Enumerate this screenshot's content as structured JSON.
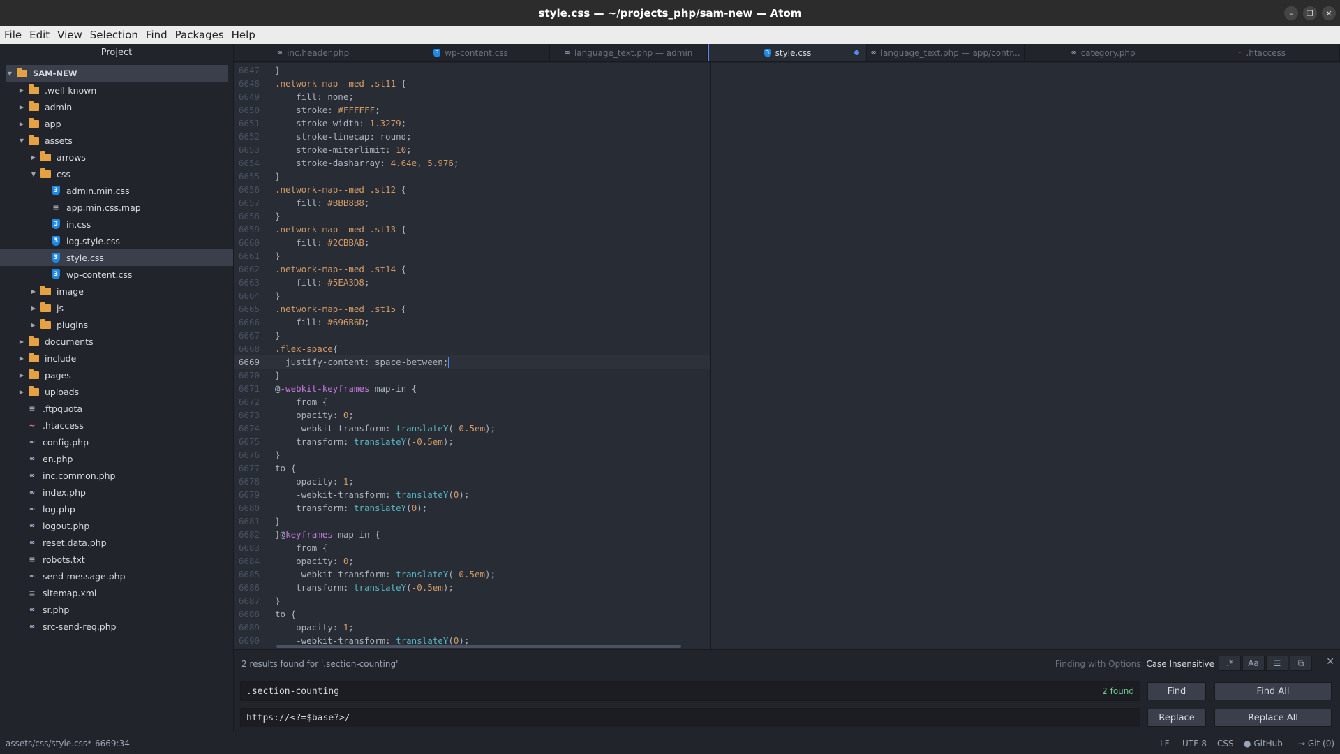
{
  "window": {
    "title": "style.css — ~/projects_php/sam-new — Atom",
    "minimize_glyph": "–",
    "restore_glyph": "❐",
    "close_glyph": "✕"
  },
  "menu": [
    "File",
    "Edit",
    "View",
    "Selection",
    "Find",
    "Packages",
    "Help"
  ],
  "tree": {
    "header": "Project",
    "root": "SAM-NEW",
    "items": [
      {
        "label": ".well-known",
        "type": "folder",
        "depth": 1,
        "expanded": false
      },
      {
        "label": "admin",
        "type": "folder",
        "depth": 1,
        "expanded": false
      },
      {
        "label": "app",
        "type": "folder",
        "depth": 1,
        "expanded": false
      },
      {
        "label": "assets",
        "type": "folder",
        "depth": 1,
        "expanded": true
      },
      {
        "label": "arrows",
        "type": "folder",
        "depth": 2,
        "expanded": false
      },
      {
        "label": "css",
        "type": "folder",
        "depth": 2,
        "expanded": true
      },
      {
        "label": "admin.min.css",
        "type": "css",
        "depth": 3
      },
      {
        "label": "app.min.css.map",
        "type": "txt",
        "depth": 3
      },
      {
        "label": "in.css",
        "type": "css",
        "depth": 3
      },
      {
        "label": "log.style.css",
        "type": "css",
        "depth": 3
      },
      {
        "label": "style.css",
        "type": "css",
        "depth": 3,
        "selected": true
      },
      {
        "label": "wp-content.css",
        "type": "css",
        "depth": 3
      },
      {
        "label": "image",
        "type": "folder",
        "depth": 2,
        "expanded": false
      },
      {
        "label": "js",
        "type": "folder",
        "depth": 2,
        "expanded": false
      },
      {
        "label": "plugins",
        "type": "folder",
        "depth": 2,
        "expanded": false
      },
      {
        "label": "documents",
        "type": "folder",
        "depth": 1,
        "expanded": false
      },
      {
        "label": "include",
        "type": "folder",
        "depth": 1,
        "expanded": false
      },
      {
        "label": "pages",
        "type": "folder",
        "depth": 1,
        "expanded": false
      },
      {
        "label": "uploads",
        "type": "folder",
        "depth": 1,
        "expanded": false
      },
      {
        "label": ".ftpquota",
        "type": "txt",
        "depth": 1
      },
      {
        "label": ".htaccess",
        "type": "ht",
        "depth": 1
      },
      {
        "label": "config.php",
        "type": "php",
        "depth": 1
      },
      {
        "label": "en.php",
        "type": "php",
        "depth": 1
      },
      {
        "label": "inc.common.php",
        "type": "php",
        "depth": 1
      },
      {
        "label": "index.php",
        "type": "php",
        "depth": 1
      },
      {
        "label": "log.php",
        "type": "php",
        "depth": 1
      },
      {
        "label": "logout.php",
        "type": "php",
        "depth": 1
      },
      {
        "label": "reset.data.php",
        "type": "php",
        "depth": 1
      },
      {
        "label": "robots.txt",
        "type": "txt",
        "depth": 1
      },
      {
        "label": "send-message.php",
        "type": "php",
        "depth": 1
      },
      {
        "label": "sitemap.xml",
        "type": "txt",
        "depth": 1
      },
      {
        "label": "sr.php",
        "type": "php",
        "depth": 1
      },
      {
        "label": "src-send-req.php",
        "type": "php",
        "depth": 1
      }
    ]
  },
  "tabs": [
    {
      "label": "inc.header.php",
      "type": "php"
    },
    {
      "label": "wp-content.css",
      "type": "css"
    },
    {
      "label": "language_text.php — admin",
      "type": "php"
    },
    {
      "label": "style.css",
      "type": "css",
      "active": true,
      "modified": true
    },
    {
      "label": "language_text.php — app/contr...",
      "type": "php"
    },
    {
      "label": "category.php",
      "type": "php"
    },
    {
      "label": ".htaccess",
      "type": "ht"
    }
  ],
  "editor": {
    "current_line": "6669",
    "lines": [
      {
        "n": "6647",
        "html": "}"
      },
      {
        "n": "6648",
        "html": "<span class='cls'>.network-map--med .st11</span> {"
      },
      {
        "n": "6649",
        "html": "    fill: none;"
      },
      {
        "n": "6650",
        "html": "    stroke: <span class='num'>#FFFFFF</span>;"
      },
      {
        "n": "6651",
        "html": "    stroke-width: <span class='num'>1.3279</span>;"
      },
      {
        "n": "6652",
        "html": "    stroke-linecap: round;"
      },
      {
        "n": "6653",
        "html": "    stroke-miterlimit: <span class='num'>10</span>;"
      },
      {
        "n": "6654",
        "html": "    stroke-dasharray: <span class='num'>4.64e</span>, <span class='num'>5.976</span>;"
      },
      {
        "n": "6655",
        "html": "}"
      },
      {
        "n": "6656",
        "html": "<span class='cls'>.network-map--med .st12</span> {"
      },
      {
        "n": "6657",
        "html": "    fill: <span class='num'>#BBB8B8</span>;"
      },
      {
        "n": "6658",
        "html": "}"
      },
      {
        "n": "6659",
        "html": "<span class='cls'>.network-map--med .st13</span> {"
      },
      {
        "n": "6660",
        "html": "    fill: <span class='num'>#2CBBAB</span>;"
      },
      {
        "n": "6661",
        "html": "}"
      },
      {
        "n": "6662",
        "html": "<span class='cls'>.network-map--med .st14</span> {"
      },
      {
        "n": "6663",
        "html": "    fill: <span class='num'>#5EA3D8</span>;"
      },
      {
        "n": "6664",
        "html": "}"
      },
      {
        "n": "6665",
        "html": "<span class='cls'>.network-map--med .st15</span> {"
      },
      {
        "n": "6666",
        "html": "    fill: <span class='num'>#696B6D</span>;"
      },
      {
        "n": "6667",
        "html": "}"
      },
      {
        "n": "6668",
        "html": "<span class='cls'>.flex-space</span>{"
      },
      {
        "n": "6669",
        "html": "  justify-content: space-between;<span class='cursor'></span>"
      },
      {
        "n": "6670",
        "html": "}"
      },
      {
        "n": "6671",
        "html": "@<span class='kw'>-webkit-keyframes</span> map-in {"
      },
      {
        "n": "6672",
        "html": "    from {"
      },
      {
        "n": "6673",
        "html": "    opacity: <span class='num'>0</span>;"
      },
      {
        "n": "6674",
        "html": "    -webkit-transform: <span class='fn'>translateY</span>(<span class='num'>-0.5em</span>);"
      },
      {
        "n": "6675",
        "html": "    transform: <span class='fn'>translateY</span>(<span class='num'>-0.5em</span>);"
      },
      {
        "n": "6676",
        "html": "}"
      },
      {
        "n": "6677",
        "html": "to {"
      },
      {
        "n": "6678",
        "html": "    opacity: <span class='num'>1</span>;"
      },
      {
        "n": "6679",
        "html": "    -webkit-transform: <span class='fn'>translateY</span>(<span class='num'>0</span>);"
      },
      {
        "n": "6680",
        "html": "    transform: <span class='fn'>translateY</span>(<span class='num'>0</span>);"
      },
      {
        "n": "6681",
        "html": "}"
      },
      {
        "n": "6682",
        "html": "}@<span class='kw'>keyframes</span> map-in {"
      },
      {
        "n": "6683",
        "html": "    from {"
      },
      {
        "n": "6684",
        "html": "    opacity: <span class='num'>0</span>;"
      },
      {
        "n": "6685",
        "html": "    -webkit-transform: <span class='fn'>translateY</span>(<span class='num'>-0.5em</span>);"
      },
      {
        "n": "6686",
        "html": "    transform: <span class='fn'>translateY</span>(<span class='num'>-0.5em</span>);"
      },
      {
        "n": "6687",
        "html": "}"
      },
      {
        "n": "6688",
        "html": "to {"
      },
      {
        "n": "6689",
        "html": "    opacity: <span class='num'>1</span>;"
      },
      {
        "n": "6690",
        "html": "    -webkit-transform: <span class='fn'>translateY</span>(<span class='num'>0</span>);"
      }
    ]
  },
  "find": {
    "status": "2 results found for '.section-counting'",
    "options_prefix": "Finding with Options:",
    "options_value": "Case Insensitive",
    "regex_label": ".*",
    "case_label": "Aa",
    "selection_label": "☰",
    "word_label": "⧉",
    "close_glyph": "✕",
    "find_value": ".section-counting",
    "found_count": "2 found",
    "replace_value": "https://<?=$base?>/",
    "find_label": "Find",
    "find_all_label": "Find All",
    "replace_label": "Replace",
    "replace_all_label": "Replace All"
  },
  "status": {
    "path": "assets/css/style.css*",
    "cursor_pos": "6669:34",
    "line_ending": "LF",
    "encoding": "UTF-8",
    "grammar": "CSS",
    "github": "GitHub",
    "git": "Git (0)"
  }
}
